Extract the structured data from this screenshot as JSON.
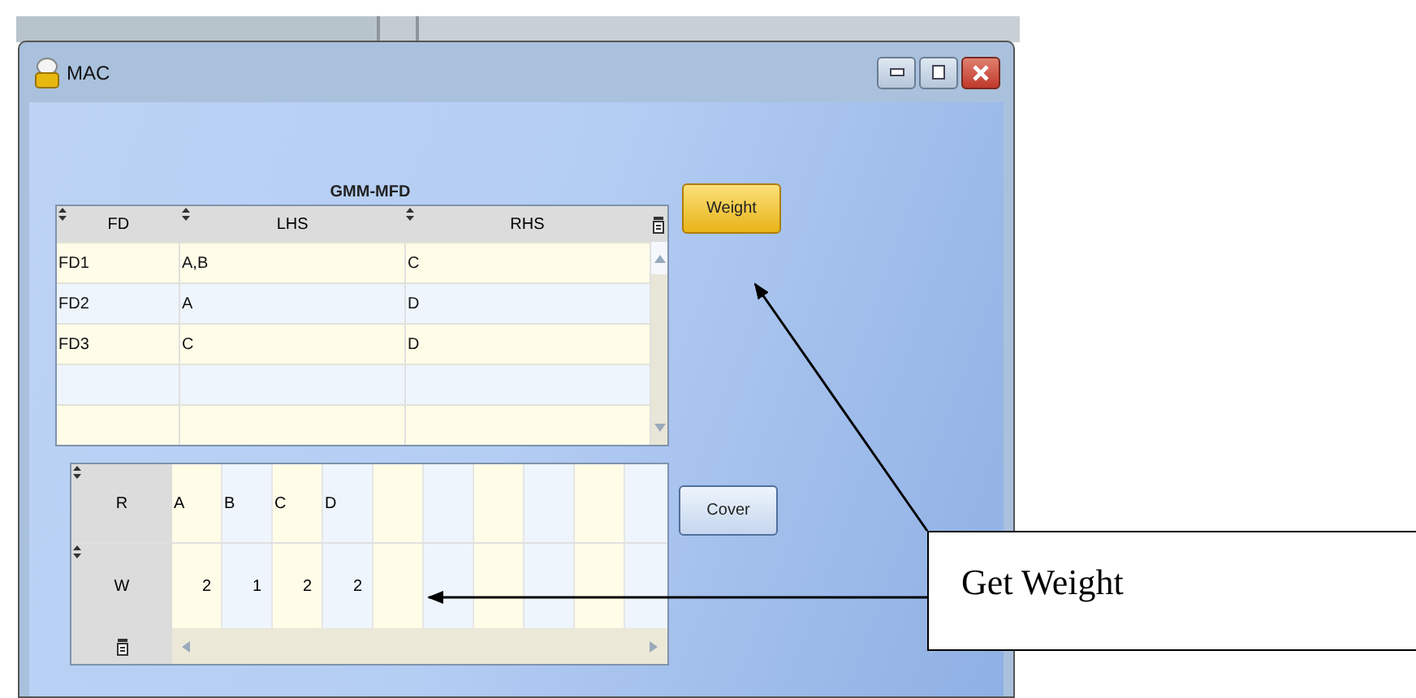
{
  "window": {
    "title": "MAC"
  },
  "fd_table": {
    "title": "GMM-MFD",
    "columns": [
      "FD",
      "LHS",
      "RHS"
    ],
    "rows": [
      [
        "FD1",
        "A,B",
        "C"
      ],
      [
        "FD2",
        "A",
        "D"
      ],
      [
        "FD3",
        "C",
        "D"
      ]
    ]
  },
  "weight_table": {
    "row_headers": [
      "R",
      "W"
    ],
    "items": [
      {
        "attribute": "A",
        "weight": "2"
      },
      {
        "attribute": "B",
        "weight": "1"
      },
      {
        "attribute": "C",
        "weight": "2"
      },
      {
        "attribute": "D",
        "weight": "2"
      }
    ]
  },
  "buttons": [
    {
      "label": "Weight",
      "highlighted": true
    },
    {
      "label": "Cover",
      "highlighted": false
    }
  ],
  "callout": {
    "text": "Get Weight"
  }
}
